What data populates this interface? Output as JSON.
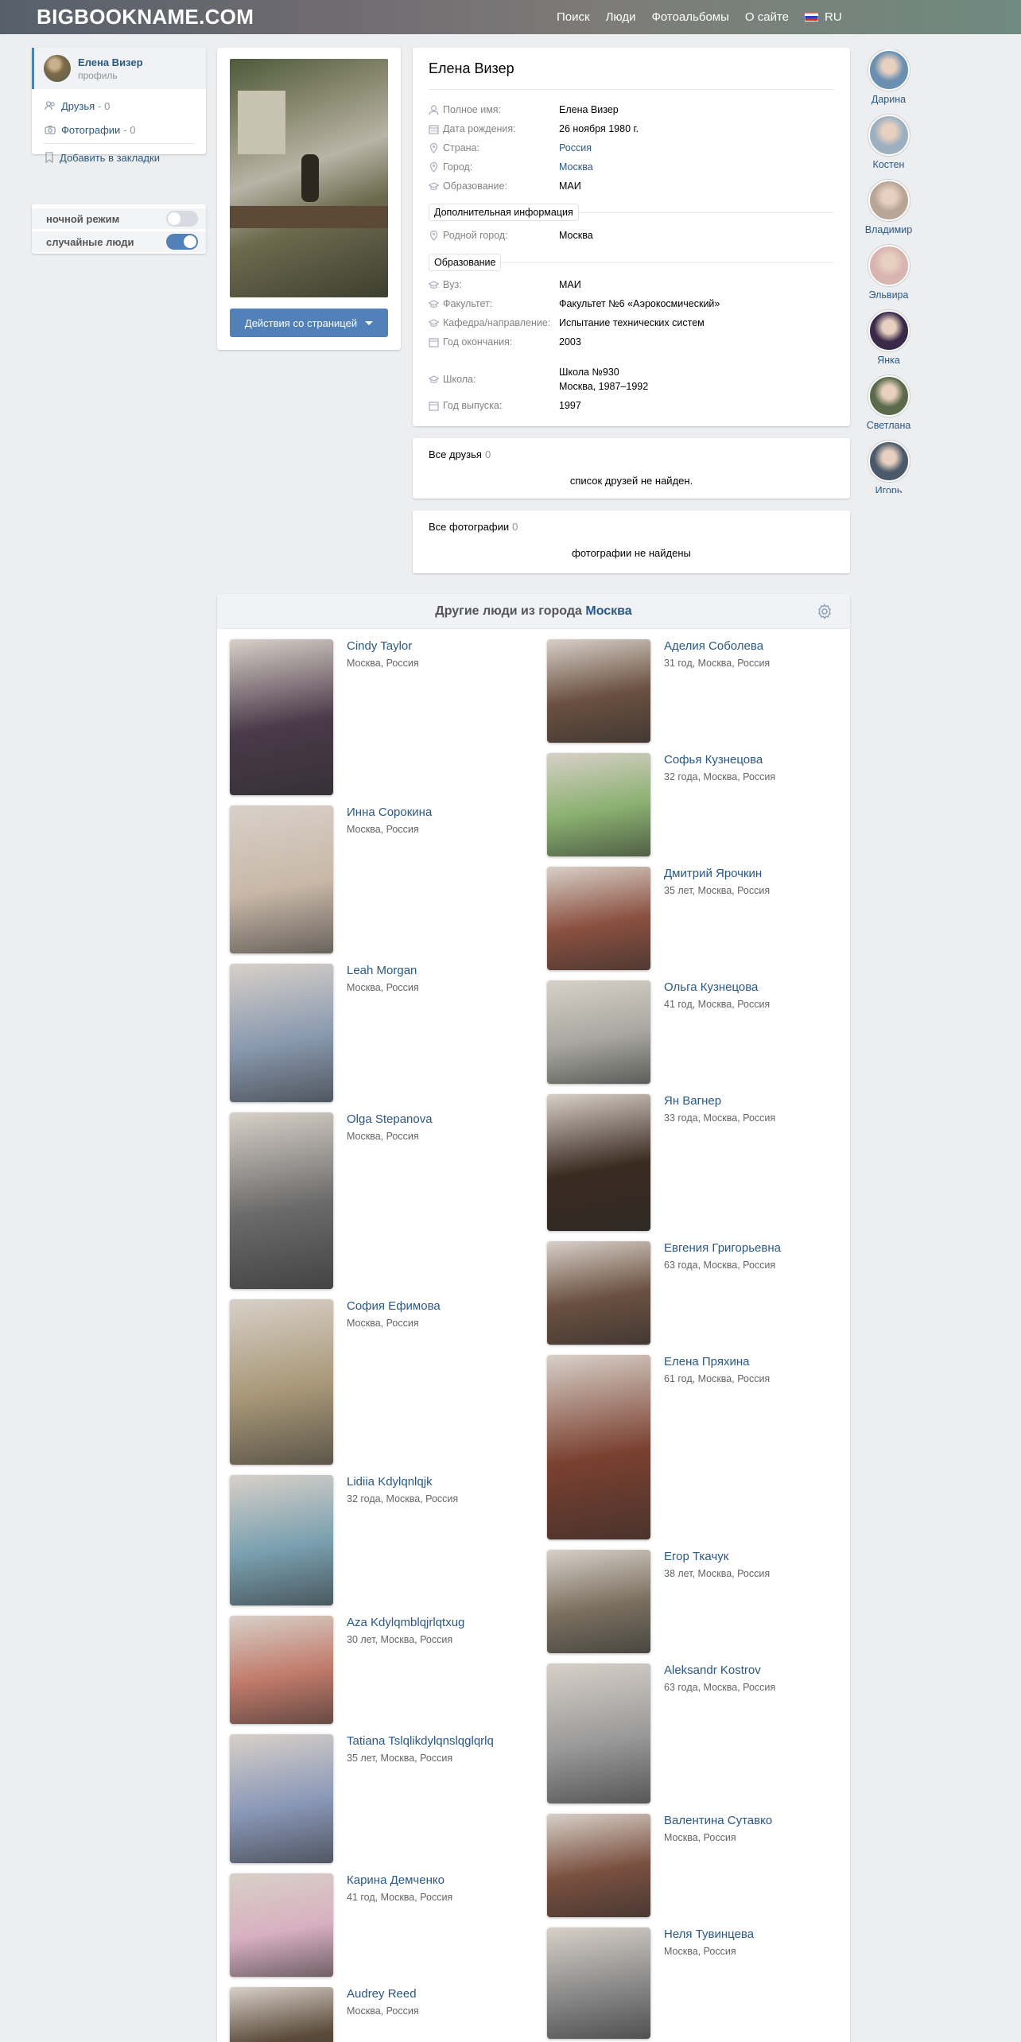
{
  "site": {
    "logo": "BIGBOOKNAME.COM",
    "nav": [
      "Поиск",
      "Люди",
      "Фотоальбомы",
      "О сайте"
    ],
    "lang": "RU"
  },
  "sidebar": {
    "user_name": "Елена Визер",
    "user_sub": "профиль",
    "friends_label": "Друзья",
    "friends_count": "- 0",
    "photos_label": "Фотографии",
    "photos_count": "- 0",
    "bookmark_label": "Добавить в закладки",
    "night_mode": {
      "label": "ночной режим",
      "on": false
    },
    "random_people": {
      "label": "случайные люди",
      "on": true
    }
  },
  "photo_card": {
    "action_button": "Действия со страницей"
  },
  "profile": {
    "name": "Елена Визер",
    "rows": {
      "full_name": {
        "label": "Полное имя:",
        "value": "Елена Визер"
      },
      "birth_date": {
        "label": "Дата рождения:",
        "value": "26 ноября 1980 г."
      },
      "country": {
        "label": "Страна:",
        "value": "Россия"
      },
      "city": {
        "label": "Город:",
        "value": "Москва"
      },
      "education": {
        "label": "Образование:",
        "value": "МАИ"
      },
      "home_city": {
        "label": "Родной город:",
        "value": "Москва"
      },
      "university": {
        "label": "Вуз:",
        "value": "МАИ"
      },
      "faculty": {
        "label": "Факультет:",
        "value": "Факультет №6 «Аэрокосмический»"
      },
      "department": {
        "label": "Кафедра/направление:",
        "value": "Испытание технических систем"
      },
      "grad_year": {
        "label": "Год окончания:",
        "value": "2003"
      },
      "school": {
        "label": "Школа:",
        "value": "Школа №930",
        "value2": "Москва, 1987–1992"
      },
      "school_year": {
        "label": "Год выпуска:",
        "value": "1997"
      }
    },
    "section_additional": "Дополнительная информация",
    "section_education": "Образование"
  },
  "friends_card": {
    "title": "Все друзья",
    "count": "0",
    "empty": "список друзей не найден."
  },
  "photos_card": {
    "title": "Все фотографии",
    "count": "0",
    "empty": "фотографии не найдены"
  },
  "right_avatars": [
    {
      "name": "Дарина",
      "color": "#6a8fb0"
    },
    {
      "name": "Костен",
      "color": "#9db0c0"
    },
    {
      "name": "Владимир",
      "color": "#b8a596"
    },
    {
      "name": "Эльвира",
      "color": "#d8b4b0"
    },
    {
      "name": "Янка",
      "color": "#3a2a4a"
    },
    {
      "name": "Светлана",
      "color": "#5a6a4a"
    },
    {
      "name": "Игорь",
      "color": "#4a5a6a"
    }
  ],
  "people": {
    "title_prefix": "Другие люди из города",
    "title_city": "Москва",
    "left": [
      {
        "name": "Cindy Taylor",
        "meta": "Москва, Россия",
        "color": "#4a3a4a"
      },
      {
        "name": "Инна Сорокина",
        "meta": "Москва, Россия",
        "color": "#c8b8a8"
      },
      {
        "name": "Leah Morgan",
        "meta": "Москва, Россия",
        "color": "#8a9ab0"
      },
      {
        "name": "Olga Stepanova",
        "meta": "Москва, Россия",
        "color": "#6a6a6a"
      },
      {
        "name": "София Ефимова",
        "meta": "Москва, Россия",
        "color": "#a89878"
      },
      {
        "name": "Lidiia Kdylqnlqjk",
        "meta": "32 года, Москва, Россия",
        "color": "#7aa0b0"
      },
      {
        "name": "Aza Kdylqmblqjrlqtxug",
        "meta": "30 лет, Москва, Россия",
        "color": "#c07a6a"
      },
      {
        "name": "Tatiana Tslqlikdylqnslqglqrlq",
        "meta": "35 лет, Москва, Россия",
        "color": "#8a98b8"
      },
      {
        "name": "Карина Демченко",
        "meta": "41 год, Москва, Россия",
        "color": "#d8b0c0"
      },
      {
        "name": "Audrey Reed",
        "meta": "Москва, Россия",
        "color": "#5a4a3a"
      }
    ],
    "right": [
      {
        "name": "Аделия Соболева",
        "meta": "31 год, Москва, Россия",
        "color": "#6a5040"
      },
      {
        "name": "Софья Кузнецова",
        "meta": "32 года, Москва, Россия",
        "color": "#8ab070"
      },
      {
        "name": "Дмитрий Ярочкин",
        "meta": "35 лет, Москва, Россия",
        "color": "#8a5040"
      },
      {
        "name": "Ольга Кузнецова",
        "meta": "41 год, Москва, Россия",
        "color": "#a8a8a0"
      },
      {
        "name": "Ян Вагнер",
        "meta": "33 года, Москва, Россия",
        "color": "#3a2a20"
      },
      {
        "name": "Евгения Григорьевна",
        "meta": "63 года, Москва, Россия",
        "color": "#6a5040"
      },
      {
        "name": "Елена Пряхина",
        "meta": "61 год, Москва, Россия",
        "color": "#7a4030"
      },
      {
        "name": "Егор Ткачук",
        "meta": "38 лет, Москва, Россия",
        "color": "#7a7060"
      },
      {
        "name": "Aleksandr Kostrov",
        "meta": "63 года, Москва, Россия",
        "color": "#9a9a9a"
      },
      {
        "name": "Валентина Сутавко",
        "meta": "Москва, Россия",
        "color": "#7a5040"
      },
      {
        "name": "Неля Тувинцева",
        "meta": "Москва, Россия",
        "color": "#8a8a8a"
      }
    ]
  }
}
